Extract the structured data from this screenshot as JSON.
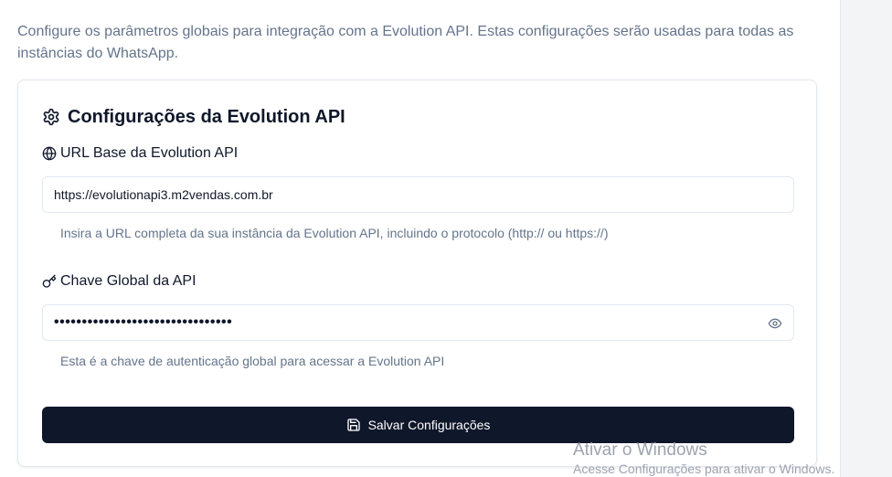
{
  "intro": "Configure os parâmetros globais para integração com a Evolution API. Estas configurações serão usadas para todas as instâncias do WhatsApp.",
  "card": {
    "title": "Configurações da Evolution API",
    "title_icon": "gear-icon"
  },
  "url_field": {
    "label": "URL Base da Evolution API",
    "icon": "globe-icon",
    "value": "https://evolutionapi3.m2vendas.com.br",
    "help": "Insira a URL completa da sua instância da Evolution API, incluindo o protocolo (http:// ou https://)"
  },
  "key_field": {
    "label": "Chave Global da API",
    "icon": "key-icon",
    "masked_value": "••••••••••••••••••••••••••••••••",
    "toggle_icon": "eye-icon",
    "help": "Esta é a chave de autenticação global para acessar a Evolution API"
  },
  "save_button": {
    "label": "Salvar Configurações",
    "icon": "save-icon"
  },
  "watermark": {
    "title": "Ativar o Windows",
    "subtitle": "Acesse Configurações para ativar o Windows."
  },
  "colors": {
    "primary": "#0f172a",
    "muted_text": "#64748b",
    "border": "#e2e8f0"
  }
}
